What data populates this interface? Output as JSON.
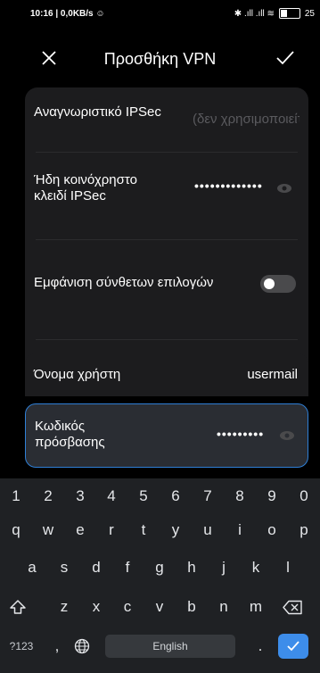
{
  "status_bar": {
    "left": "10:16 | 0,0KB/s ☺",
    "right": "✱ .ıll .ıll ≋",
    "battery": "25"
  },
  "header": {
    "title": "Προσθήκη VPN"
  },
  "form": {
    "ipsec_id_label": "Αναγνωριστικό IPSec",
    "ipsec_id_placeholder": "(δεν χρησιμοποιείται)",
    "ipsec_key_label": "Ήδη κοινόχρηστο κλειδί IPSec",
    "ipsec_key_value": "•••••••••••••",
    "advanced_label": "Εμφάνιση σύνθετων επιλογών",
    "advanced_on": false,
    "username_label": "Όνομα χρήστη",
    "username_value": "usermail",
    "password_label": "Κωδικός πρόσβασης",
    "password_value": "•••••••••"
  },
  "keyboard": {
    "numbers": [
      "1",
      "2",
      "3",
      "4",
      "5",
      "6",
      "7",
      "8",
      "9",
      "0"
    ],
    "row1": [
      "q",
      "w",
      "e",
      "r",
      "t",
      "y",
      "u",
      "i",
      "o",
      "p"
    ],
    "row2": [
      "a",
      "s",
      "d",
      "f",
      "g",
      "h",
      "j",
      "k",
      "l"
    ],
    "row3": [
      "z",
      "x",
      "c",
      "v",
      "b",
      "n",
      "m"
    ],
    "symbols_label": "?123",
    "comma": ",",
    "space_label": "English",
    "period": ".",
    "accent_color": "#3d8dea"
  }
}
